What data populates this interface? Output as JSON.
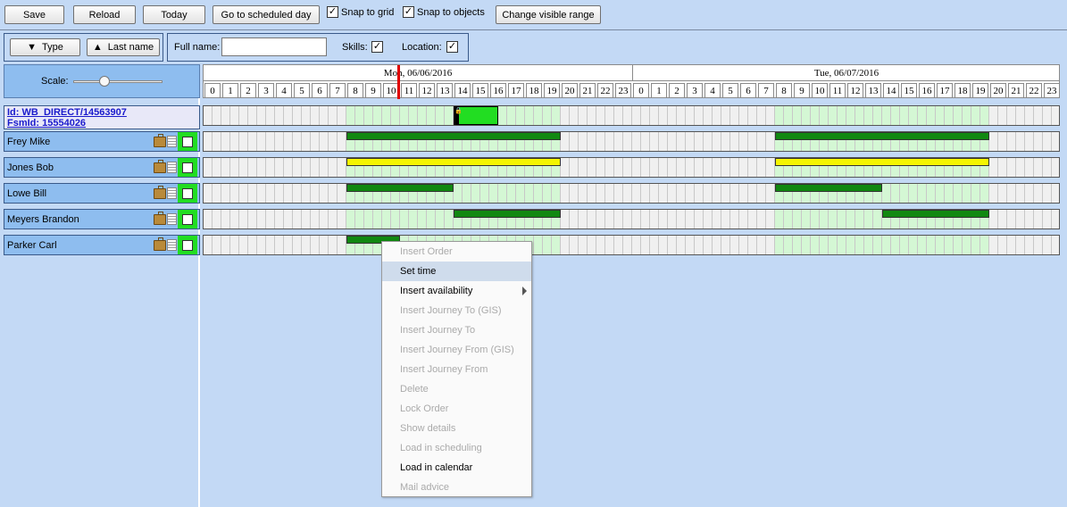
{
  "toolbar": {
    "buttons": [
      {
        "key": "save",
        "label": "Save"
      },
      {
        "key": "reload",
        "label": "Reload"
      },
      {
        "key": "today",
        "label": "Today"
      },
      {
        "key": "go",
        "label": "Go to scheduled day"
      },
      {
        "key": "range",
        "label": "Change visible range"
      }
    ],
    "snap_grid_label": "Snap to grid",
    "snap_grid_checked": true,
    "snap_objects_label": "Snap to objects",
    "snap_objects_checked": true
  },
  "sort": {
    "type_label": "Type",
    "lastname_label": "Last name"
  },
  "filter": {
    "fullname_label": "Full name:",
    "fullname_value": "",
    "skills_label": "Skills:",
    "skills_checked": true,
    "location_label": "Location:",
    "location_checked": true
  },
  "scale": {
    "label": "Scale:",
    "value": 0.3
  },
  "order": {
    "id_text": "Id: WB_DIRECT/14563907",
    "fsmid_text": "FsmId: 15554026"
  },
  "timeline": {
    "days": [
      "Mon, 06/06/2016",
      "Tue, 06/07/2016"
    ],
    "hours": [
      "0",
      "1",
      "2",
      "3",
      "4",
      "5",
      "6",
      "7",
      "8",
      "9",
      "10",
      "11",
      "12",
      "13",
      "14",
      "15",
      "16",
      "17",
      "18",
      "19",
      "20",
      "21",
      "22",
      "23"
    ],
    "current_hour": 10.9,
    "working_hours": [
      8,
      20
    ]
  },
  "resources": [
    {
      "name": "Frey Mike",
      "bars": [
        {
          "day": 0,
          "start": 8,
          "end": 20,
          "color": "#118811"
        },
        {
          "day": 1,
          "start": 8,
          "end": 20,
          "color": "#118811"
        }
      ]
    },
    {
      "name": "Jones Bob",
      "bars": [
        {
          "day": 0,
          "start": 8,
          "end": 20,
          "color": "#f5f500"
        },
        {
          "day": 1,
          "start": 8,
          "end": 20,
          "color": "#f5f500"
        }
      ]
    },
    {
      "name": "Lowe Bill",
      "bars": [
        {
          "day": 0,
          "start": 8,
          "end": 14,
          "color": "#118811"
        },
        {
          "day": 1,
          "start": 8,
          "end": 14,
          "color": "#118811"
        }
      ]
    },
    {
      "name": "Meyers Brandon",
      "bars": [
        {
          "day": 0,
          "start": 14,
          "end": 20,
          "color": "#118811"
        },
        {
          "day": 1,
          "start": 14,
          "end": 20,
          "color": "#118811"
        }
      ]
    },
    {
      "name": "Parker Carl",
      "bars": [
        {
          "day": 0,
          "start": 8,
          "end": 11,
          "color": "#118811"
        }
      ]
    }
  ],
  "order_block": {
    "day": 0,
    "start": 14,
    "end": 16.5
  },
  "context_menu": {
    "items": [
      {
        "label": "Insert Order",
        "enabled": false
      },
      {
        "label": "Set time",
        "enabled": true,
        "highlighted": true
      },
      {
        "label": "Insert availability",
        "enabled": true,
        "submenu": true
      },
      {
        "label": "Insert Journey To (GIS)",
        "enabled": false
      },
      {
        "label": "Insert Journey To",
        "enabled": false
      },
      {
        "label": "Insert Journey From (GIS)",
        "enabled": false
      },
      {
        "label": "Insert Journey From",
        "enabled": false
      },
      {
        "label": "Delete",
        "enabled": false
      },
      {
        "label": "Lock Order",
        "enabled": false
      },
      {
        "label": "Show details",
        "enabled": false
      },
      {
        "label": "Load in scheduling",
        "enabled": false
      },
      {
        "label": "Load in calendar",
        "enabled": true
      },
      {
        "label": "Mail advice",
        "enabled": false
      }
    ]
  },
  "colors": {
    "work_bg": "#d4f7d4",
    "off_bg": "#f0f0f0",
    "cell_line": "#c8c8c8",
    "order_green": "#22dd22",
    "now_line": "#e00000"
  }
}
